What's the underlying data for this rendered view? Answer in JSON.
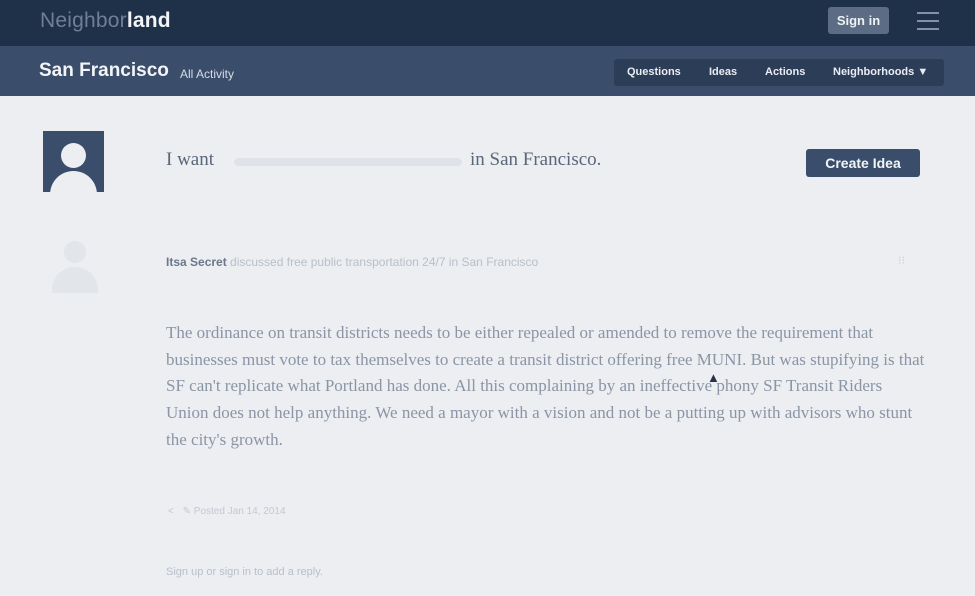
{
  "header": {
    "logo_part1": "Neighbor",
    "logo_part2": "land",
    "signin_label": "Sign in"
  },
  "subheader": {
    "city": "San Francisco",
    "all_activity": "All Activity",
    "nav": [
      "Questions",
      "Ideas",
      "Actions",
      "Neighborhoods ▼"
    ]
  },
  "idea_prompt": {
    "prefix": "I want",
    "suffix": "in San Francisco.",
    "create_label": "Create Idea"
  },
  "post": {
    "author": "Itsa Secret",
    "byline_text": " discussed free public transportation 24/7 in San Francisco",
    "corner": "⁝⁝",
    "body": "The ordinance on transit districts needs to be either repealed or amended to remove the requirement that businesses must vote to tax themselves to create a transit district offering free MUNI. But was stupifying is that SF can't replicate what Portland has done. All this complaining by an ineffective phony SF Transit Riders Union does not help anything. We need a mayor with a vision and not be a putting up with advisors who stunt the city's growth.",
    "share_icon": "share-icon",
    "posted": "✎ Posted Jan 14, 2014"
  },
  "reply_prompt": "Sign up or sign in to add a reply.",
  "colors": {
    "topbar": "#1f3049",
    "subbar": "#3a4d6b",
    "accent": "#3a4d6b",
    "background": "#eceef1"
  }
}
